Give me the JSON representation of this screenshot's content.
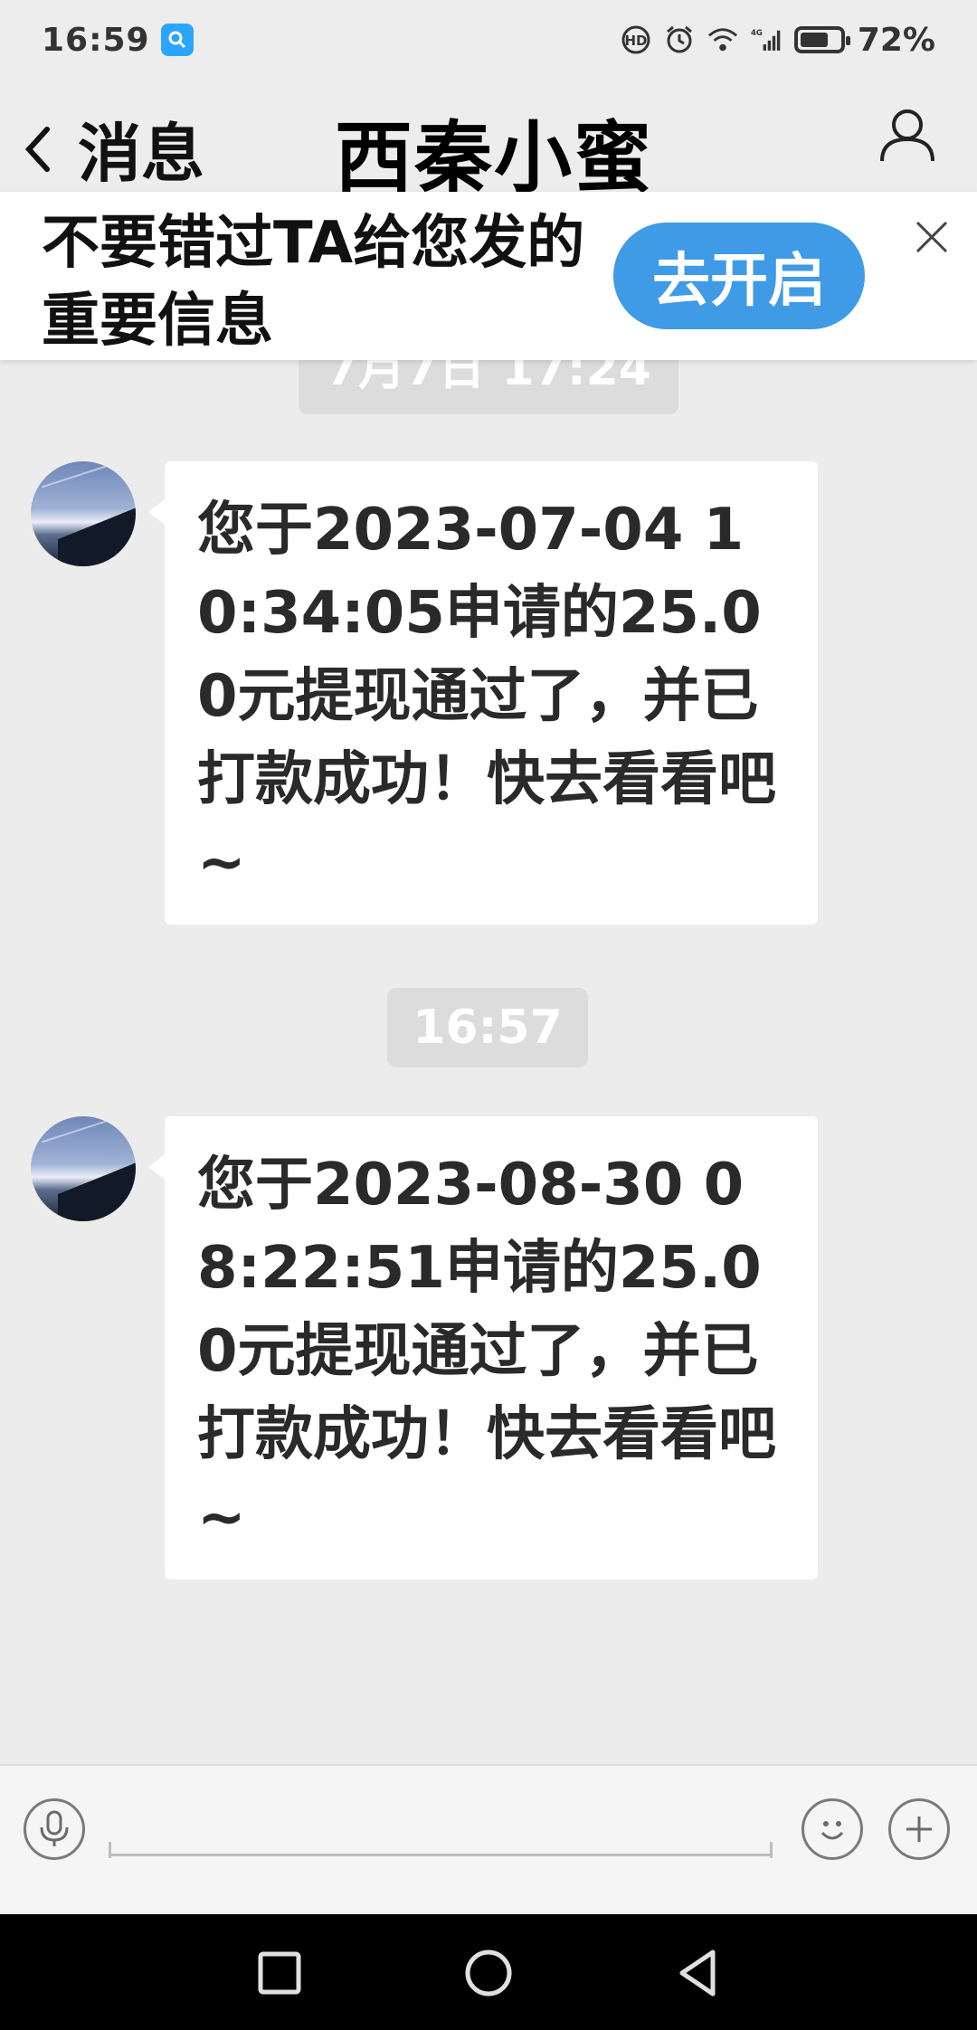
{
  "status_bar": {
    "time": "16:59",
    "battery": "72%",
    "battery_level": 0.72,
    "icons": [
      "search-notification-icon",
      "hd-call-icon",
      "alarm-icon",
      "wifi-icon",
      "signal-4g-icon",
      "battery-icon"
    ]
  },
  "header": {
    "back_label": "消息",
    "title": "西秦小蜜",
    "icons": [
      "back-chevron-icon",
      "profile-icon"
    ]
  },
  "banner": {
    "text": "不要错过TA给您发的重要信息",
    "button_label": "去开启",
    "close_icon": "close-icon"
  },
  "chat": {
    "partial_timestamp": "7月7日 17:24",
    "timestamp": "16:57",
    "messages": [
      {
        "text": "您于2023-07-04 10:34:05申请的25.00元提现通过了，并已打款成功！快去看看吧~"
      },
      {
        "text": "您于2023-08-30 08:22:51申请的25.00元提现通过了，并已打款成功！快去看看吧~"
      }
    ]
  },
  "input_bar": {
    "placeholder": "",
    "icons": [
      "microphone-icon",
      "emoji-icon",
      "plus-icon"
    ]
  },
  "nav_bar": {
    "icons": [
      "recent-apps-icon",
      "home-icon",
      "back-triangle-icon"
    ]
  },
  "colors": {
    "background": "#ececec",
    "accent_button": "#3f9be6",
    "bubble": "#ffffff",
    "timestamp_pill": "#dcdcdc"
  }
}
